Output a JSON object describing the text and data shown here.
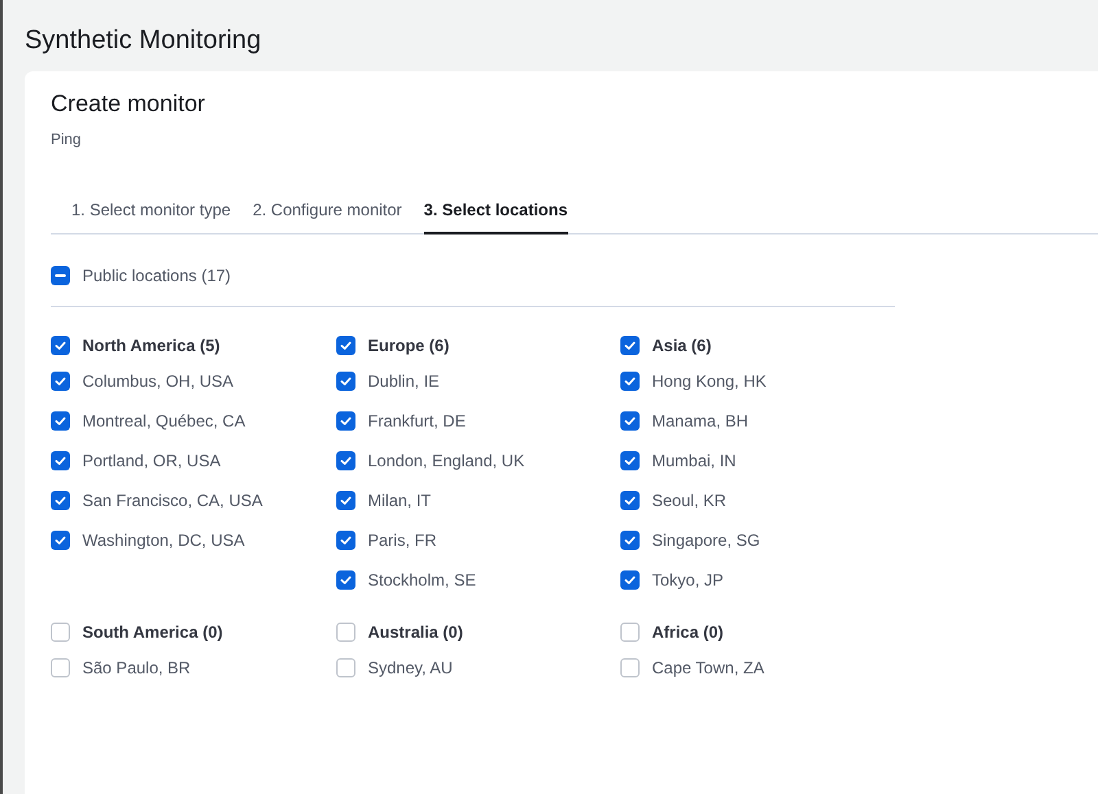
{
  "page_title": "Synthetic Monitoring",
  "card": {
    "title": "Create monitor",
    "subtitle": "Ping"
  },
  "tabs": [
    {
      "label": "1. Select monitor type",
      "selected": false
    },
    {
      "label": "2. Configure monitor",
      "selected": false
    },
    {
      "label": "3. Select locations",
      "selected": true
    }
  ],
  "public_locations": {
    "label": "Public locations (17)",
    "indeterminate": true
  },
  "location_groups": [
    {
      "label": "North America (5)",
      "checked": true,
      "items": [
        {
          "label": "Columbus, OH, USA",
          "checked": true
        },
        {
          "label": "Montreal, Québec, CA",
          "checked": true
        },
        {
          "label": "Portland, OR, USA",
          "checked": true
        },
        {
          "label": "San Francisco, CA, USA",
          "checked": true
        },
        {
          "label": "Washington, DC, USA",
          "checked": true
        }
      ]
    },
    {
      "label": "Europe (6)",
      "checked": true,
      "items": [
        {
          "label": "Dublin, IE",
          "checked": true
        },
        {
          "label": "Frankfurt, DE",
          "checked": true
        },
        {
          "label": "London, England, UK",
          "checked": true
        },
        {
          "label": "Milan, IT",
          "checked": true
        },
        {
          "label": "Paris, FR",
          "checked": true
        },
        {
          "label": "Stockholm, SE",
          "checked": true
        }
      ]
    },
    {
      "label": "Asia (6)",
      "checked": true,
      "items": [
        {
          "label": "Hong Kong, HK",
          "checked": true
        },
        {
          "label": "Manama, BH",
          "checked": true
        },
        {
          "label": "Mumbai, IN",
          "checked": true
        },
        {
          "label": "Seoul, KR",
          "checked": true
        },
        {
          "label": "Singapore, SG",
          "checked": true
        },
        {
          "label": "Tokyo, JP",
          "checked": true
        }
      ]
    },
    {
      "label": "South America (0)",
      "checked": false,
      "items": [
        {
          "label": "São Paulo, BR",
          "checked": false
        }
      ]
    },
    {
      "label": "Australia (0)",
      "checked": false,
      "items": [
        {
          "label": "Sydney, AU",
          "checked": false
        }
      ]
    },
    {
      "label": "Africa (0)",
      "checked": false,
      "items": [
        {
          "label": "Cape Town, ZA",
          "checked": false
        }
      ]
    }
  ]
}
